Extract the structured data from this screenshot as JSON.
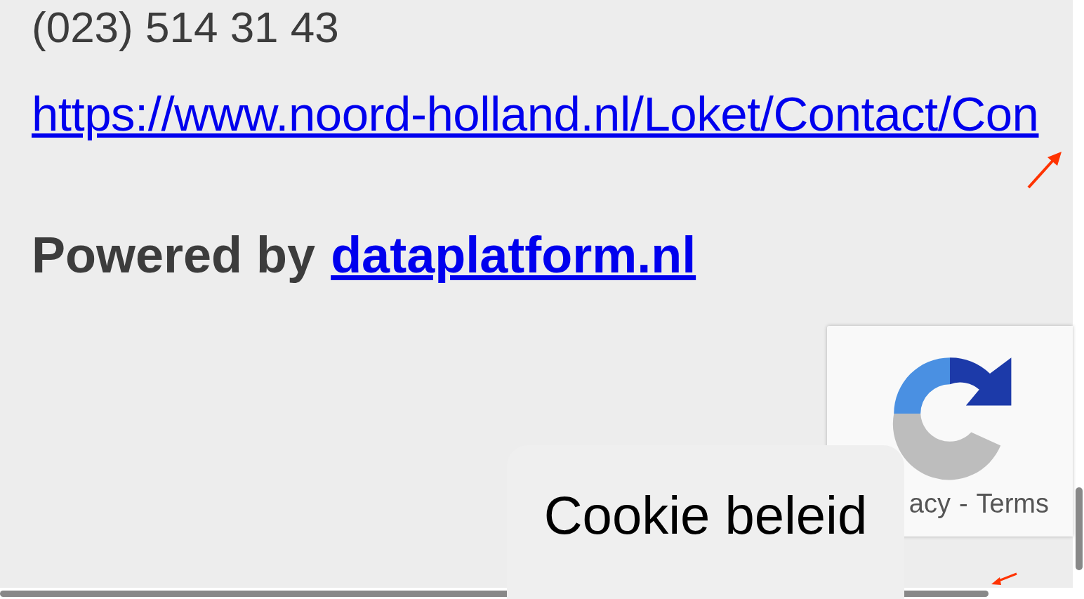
{
  "contact": {
    "phone": "(023) 514 31 43",
    "url": "https://www.noord-holland.nl/Loket/Contact/Con"
  },
  "footer": {
    "powered_label": "Powered by",
    "powered_link": "dataplatform.nl"
  },
  "recaptcha": {
    "links": [
      "acy",
      "-",
      "Terms"
    ]
  },
  "cookie_button": {
    "label": "Cookie beleid"
  }
}
